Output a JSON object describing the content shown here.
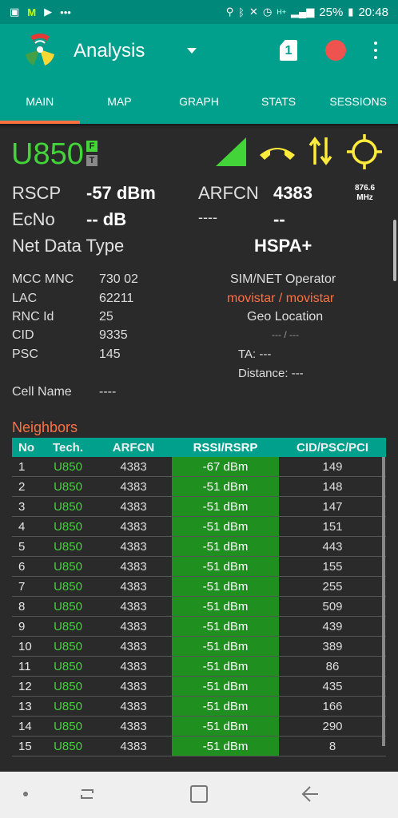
{
  "status": {
    "battery": "25%",
    "time": "20:48",
    "network": "H+"
  },
  "appbar": {
    "title": "Analysis",
    "sim_slot": "1"
  },
  "tabs": [
    "MAIN",
    "MAP",
    "GRAPH",
    "STATS",
    "SESSIONS"
  ],
  "serving": {
    "tech": "U850",
    "badge_f": "F",
    "badge_t": "T",
    "rscp_label": "RSCP",
    "rscp_value": "-57 dBm",
    "arfcn_label": "ARFCN",
    "arfcn_value": "4383",
    "freq": "876.6",
    "freq_unit": "MHz",
    "ecno_label": "EcNo",
    "ecno_value": "-- dB",
    "blank_label": "----",
    "blank_value": "--",
    "netdata_label": "Net Data Type",
    "netdata_value": "HSPA+"
  },
  "cellinfo": {
    "mccmnc_label": "MCC MNC",
    "mccmnc_value": "730 02",
    "lac_label": "LAC",
    "lac_value": "62211",
    "rnc_label": "RNC Id",
    "rnc_value": "25",
    "cid_label": "CID",
    "cid_value": "9335",
    "psc_label": "PSC",
    "psc_value": "145",
    "cellname_label": "Cell Name",
    "cellname_value": "----",
    "operator_label": "SIM/NET Operator",
    "operator_value": "movistar / movistar",
    "geo_label": "Geo Location",
    "geo_value": "--- / ---",
    "ta_label": "TA: ---",
    "distance_label": "Distance: ---"
  },
  "neighbors": {
    "title": "Neighbors",
    "headers": [
      "No",
      "Tech.",
      "ARFCN",
      "RSSI/RSRP",
      "CID/PSC/PCI"
    ],
    "rows": [
      [
        "1",
        "U850",
        "4383",
        "-67 dBm",
        "149"
      ],
      [
        "2",
        "U850",
        "4383",
        "-51 dBm",
        "148"
      ],
      [
        "3",
        "U850",
        "4383",
        "-51 dBm",
        "147"
      ],
      [
        "4",
        "U850",
        "4383",
        "-51 dBm",
        "151"
      ],
      [
        "5",
        "U850",
        "4383",
        "-51 dBm",
        "443"
      ],
      [
        "6",
        "U850",
        "4383",
        "-51 dBm",
        "155"
      ],
      [
        "7",
        "U850",
        "4383",
        "-51 dBm",
        "255"
      ],
      [
        "8",
        "U850",
        "4383",
        "-51 dBm",
        "509"
      ],
      [
        "9",
        "U850",
        "4383",
        "-51 dBm",
        "439"
      ],
      [
        "10",
        "U850",
        "4383",
        "-51 dBm",
        "389"
      ],
      [
        "11",
        "U850",
        "4383",
        "-51 dBm",
        "86"
      ],
      [
        "12",
        "U850",
        "4383",
        "-51 dBm",
        "435"
      ],
      [
        "13",
        "U850",
        "4383",
        "-51 dBm",
        "166"
      ],
      [
        "14",
        "U850",
        "4383",
        "-51 dBm",
        "290"
      ],
      [
        "15",
        "U850",
        "4383",
        "-51 dBm",
        "8"
      ]
    ]
  },
  "colors": {
    "accent": "#00a08d",
    "status": "#00897b",
    "tech_green": "#43d43a",
    "orange": "#ff7043",
    "record_red": "#ef5350"
  }
}
